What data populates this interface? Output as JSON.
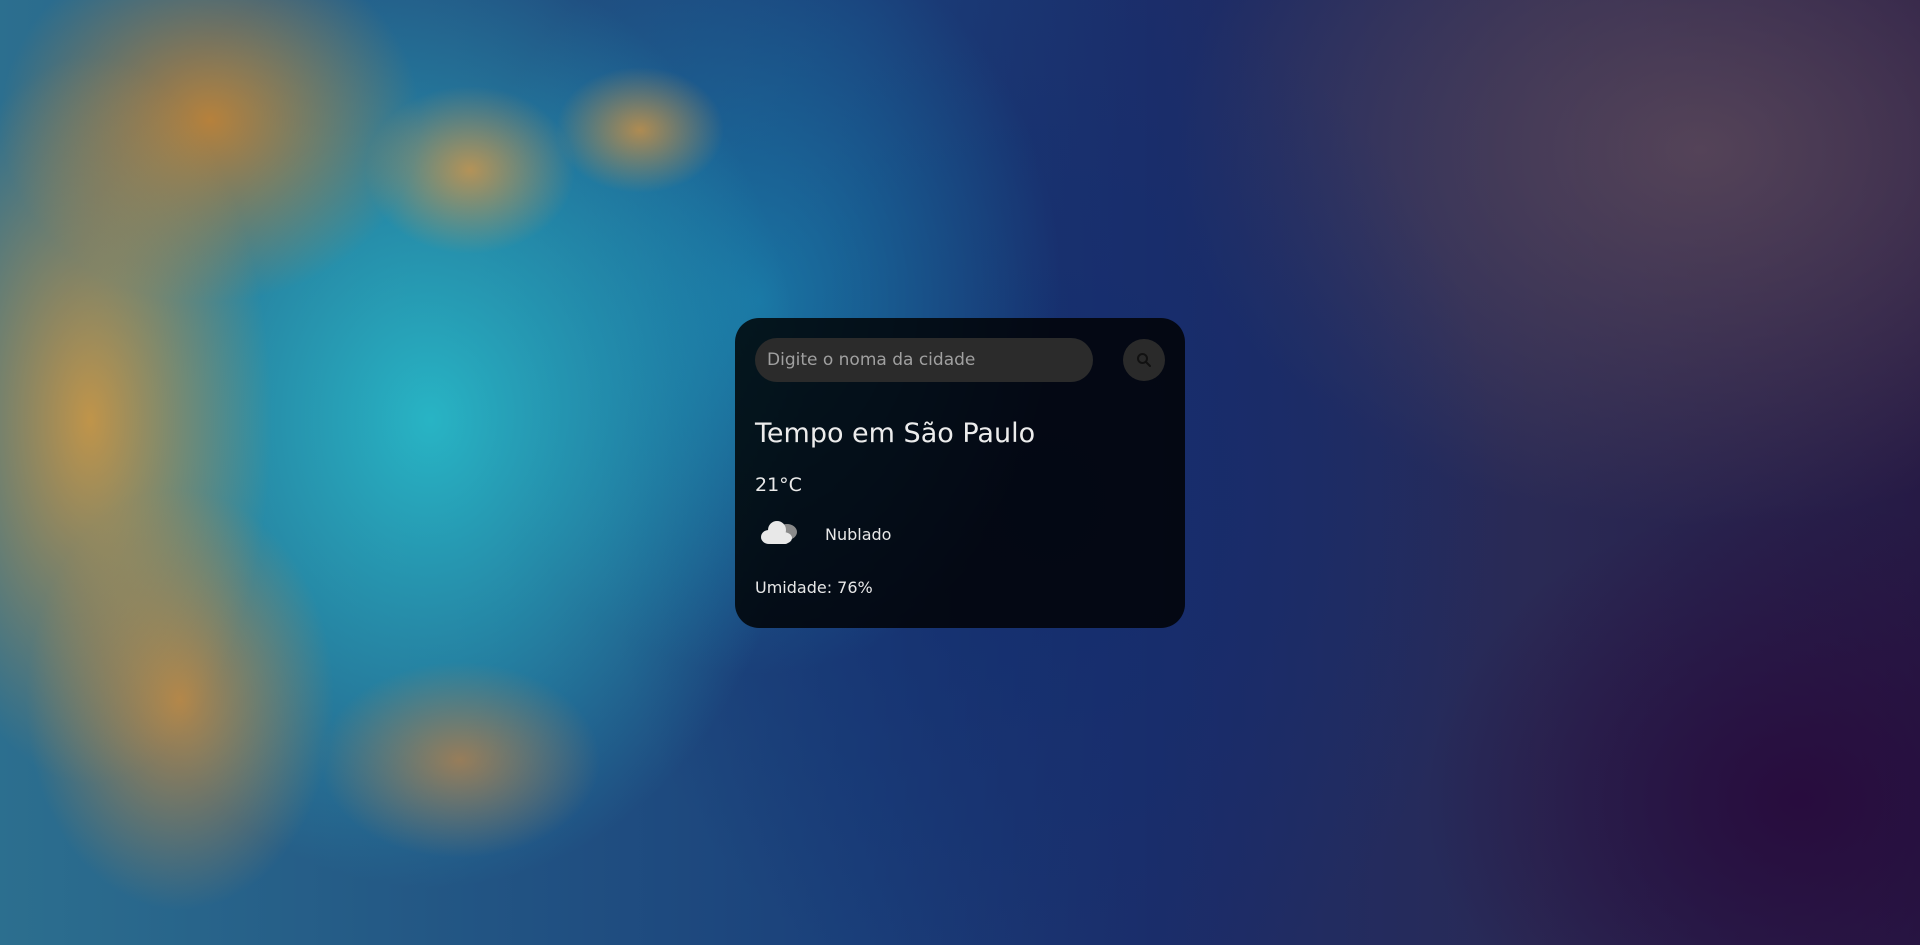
{
  "search": {
    "placeholder": "Digite o noma da cidade",
    "value": "",
    "button_icon": "search-icon"
  },
  "weather": {
    "title": "Tempo em São Paulo",
    "temperature": "21°C",
    "condition": "Nublado",
    "condition_icon": "cloud-icon",
    "humidity": "Umidade: 76%"
  },
  "colors": {
    "card_background": "#000000",
    "input_background": "#2b2b2b",
    "text": "#f2f2f2"
  }
}
